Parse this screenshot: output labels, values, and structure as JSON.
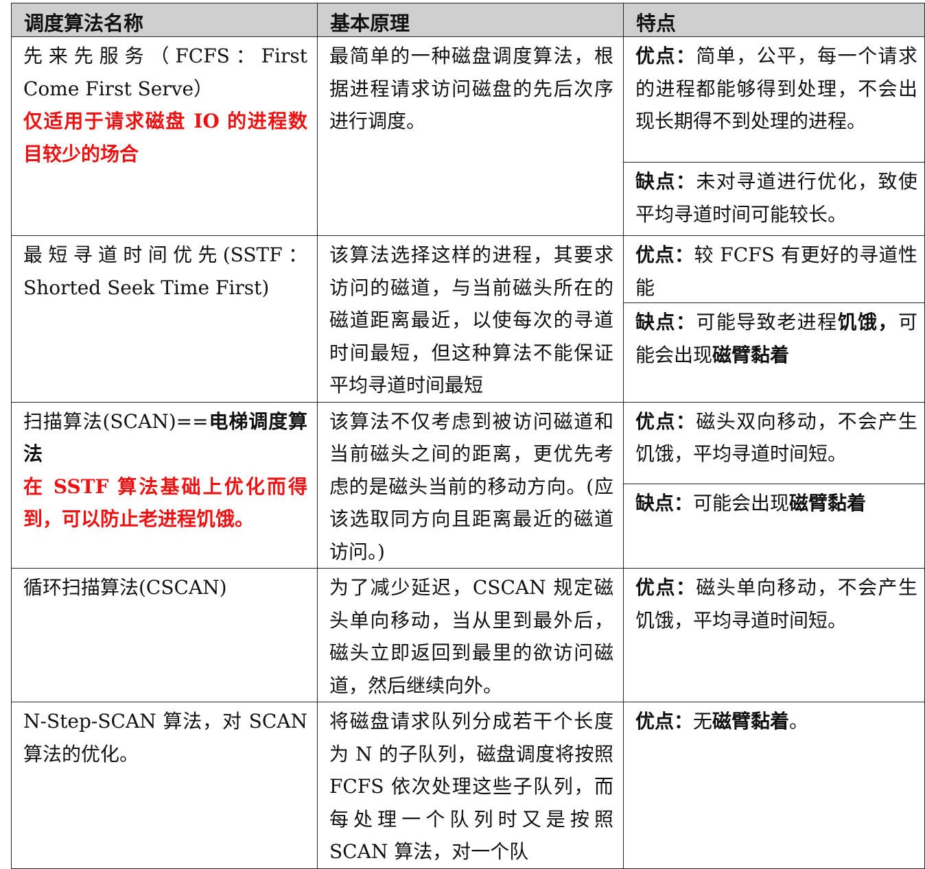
{
  "headers": [
    "调度算法名称",
    "基本原理",
    "特点"
  ],
  "rows": [
    {
      "name": "先来先服务（FCFS：First Come First Serve）",
      "note": "仅适用于请求磁盘 IO 的进程数目较少的场合",
      "principle": "最简单的一种磁盘调度算法，根据进程请求访问磁盘的先后次序进行调度。",
      "pros_label": "优点：",
      "pros_text": "简单，公平，每一个请求的进程都能够得到处理，不会出现长期得不到处理的进程。",
      "cons_label": "缺点：",
      "cons_text": "未对寻道进行优化，致使平均寻道时间可能较长。"
    },
    {
      "name": "最短寻道时间优先(SSTF：Shorted Seek Time First)",
      "principle": "该算法选择这样的进程，其要求访问的磁道，与当前磁头所在的磁道距离最近，以使每次的寻道时间最短，但这种算法不能保证平均寻道时间最短",
      "pros_label": "优点：",
      "pros_text": "较 FCFS 有更好的寻道性能",
      "cons_label": "缺点：",
      "cons_text_a": "可能导致老进程",
      "cons_bold_a": "饥饿，",
      "cons_text_b": "可能会出现",
      "cons_bold_b": "磁臂黏着"
    },
    {
      "name_a": "扫描算法(SCAN)==",
      "name_bold": "电梯调度算法",
      "note": "在 SSTF 算法基础上优化而得到，可以防止老进程饥饿。",
      "principle": "该算法不仅考虑到被访问磁道和当前磁头之间的距离，更优先考虑的是磁头当前的移动方向。(应该选取同方向且距离最近的磁道访问。)",
      "pros_label": "优点：",
      "pros_text": "磁头双向移动，不会产生饥饿，平均寻道时间短。",
      "cons_label": "缺点：",
      "cons_text": "可能会出现",
      "cons_bold": "磁臂黏着"
    },
    {
      "name": "循环扫描算法(CSCAN)",
      "principle": "为了减少延迟，CSCAN 规定磁头单向移动，当从里到最外后，磁头立即返回到最里的欲访问磁道，然后继续向外。",
      "pros_label": "优点：",
      "pros_text": "磁头单向移动，不会产生饥饿，平均寻道时间短。"
    },
    {
      "name": "N-Step-SCAN 算法，对 SCAN 算法的优化。",
      "principle": "将磁盘请求队列分成若干个长度为 N 的子队列，磁盘调度将按照 FCFS 依次处理这些子队列，而每处理一个队列时又是按照 SCAN 算法，对一个队",
      "pros_label": "优点：",
      "pros_text": "无",
      "pros_bold": "磁臂黏着",
      "pros_tail": "。"
    }
  ]
}
